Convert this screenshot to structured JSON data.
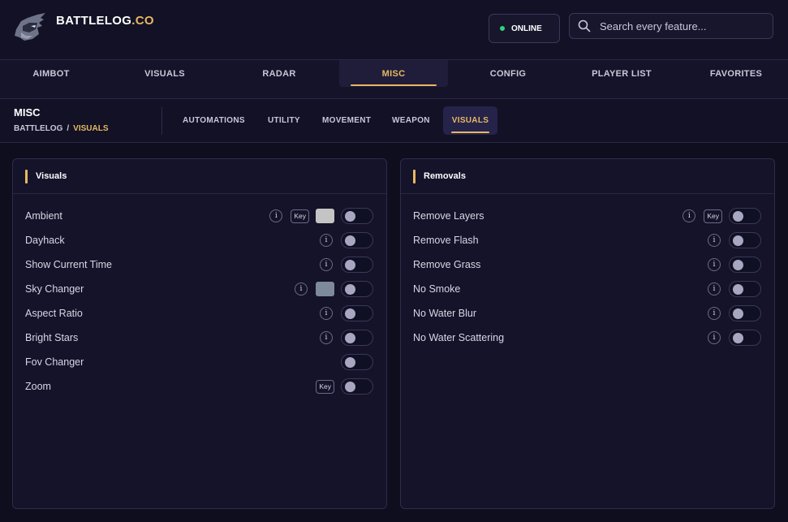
{
  "brand": {
    "name": "BATTLELOG",
    "suffix": ".CO"
  },
  "status": {
    "label": "ONLINE",
    "color": "#34d17a"
  },
  "search": {
    "placeholder": "Search every feature..."
  },
  "theme": {
    "accent": "#e8b861",
    "background": "#0f0e1f"
  },
  "main_tabs": [
    {
      "label": "AIMBOT",
      "active": false
    },
    {
      "label": "VISUALS",
      "active": false
    },
    {
      "label": "RADAR",
      "active": false
    },
    {
      "label": "MISC",
      "active": true
    },
    {
      "label": "CONFIG",
      "active": false
    },
    {
      "label": "PLAYER LIST",
      "active": false
    },
    {
      "label": "FAVORITES",
      "active": false
    }
  ],
  "section": {
    "title": "MISC",
    "breadcrumb": [
      "BATTLELOG",
      "VISUALS"
    ],
    "breadcrumb_sep": "/"
  },
  "sub_tabs": [
    {
      "label": "AUTOMATIONS",
      "active": false
    },
    {
      "label": "UTILITY",
      "active": false
    },
    {
      "label": "MOVEMENT",
      "active": false
    },
    {
      "label": "WEAPON",
      "active": false
    },
    {
      "label": "VISUALS",
      "active": true
    }
  ],
  "labels": {
    "info": "i",
    "key": "Key"
  },
  "panels": [
    {
      "title": "Visuals",
      "rows": [
        {
          "label": "Ambient",
          "info": true,
          "key": true,
          "swatch": "#c4c4c4",
          "enabled": false
        },
        {
          "label": "Dayhack",
          "info": true,
          "key": false,
          "swatch": null,
          "enabled": false
        },
        {
          "label": "Show Current Time",
          "info": true,
          "key": false,
          "swatch": null,
          "enabled": false
        },
        {
          "label": "Sky Changer",
          "info": true,
          "key": false,
          "swatch": "#7d8a9c",
          "enabled": false
        },
        {
          "label": "Aspect Ratio",
          "info": true,
          "key": false,
          "swatch": null,
          "enabled": false
        },
        {
          "label": "Bright Stars",
          "info": true,
          "key": false,
          "swatch": null,
          "enabled": false
        },
        {
          "label": "Fov Changer",
          "info": false,
          "key": false,
          "swatch": null,
          "enabled": false
        },
        {
          "label": "Zoom",
          "info": false,
          "key": true,
          "swatch": null,
          "enabled": false
        }
      ]
    },
    {
      "title": "Removals",
      "rows": [
        {
          "label": "Remove Layers",
          "info": true,
          "key": true,
          "swatch": null,
          "enabled": false
        },
        {
          "label": "Remove Flash",
          "info": true,
          "key": false,
          "swatch": null,
          "enabled": false
        },
        {
          "label": "Remove Grass",
          "info": true,
          "key": false,
          "swatch": null,
          "enabled": false
        },
        {
          "label": "No Smoke",
          "info": true,
          "key": false,
          "swatch": null,
          "enabled": false
        },
        {
          "label": "No Water Blur",
          "info": true,
          "key": false,
          "swatch": null,
          "enabled": false
        },
        {
          "label": "No Water Scattering",
          "info": true,
          "key": false,
          "swatch": null,
          "enabled": false
        }
      ]
    }
  ]
}
